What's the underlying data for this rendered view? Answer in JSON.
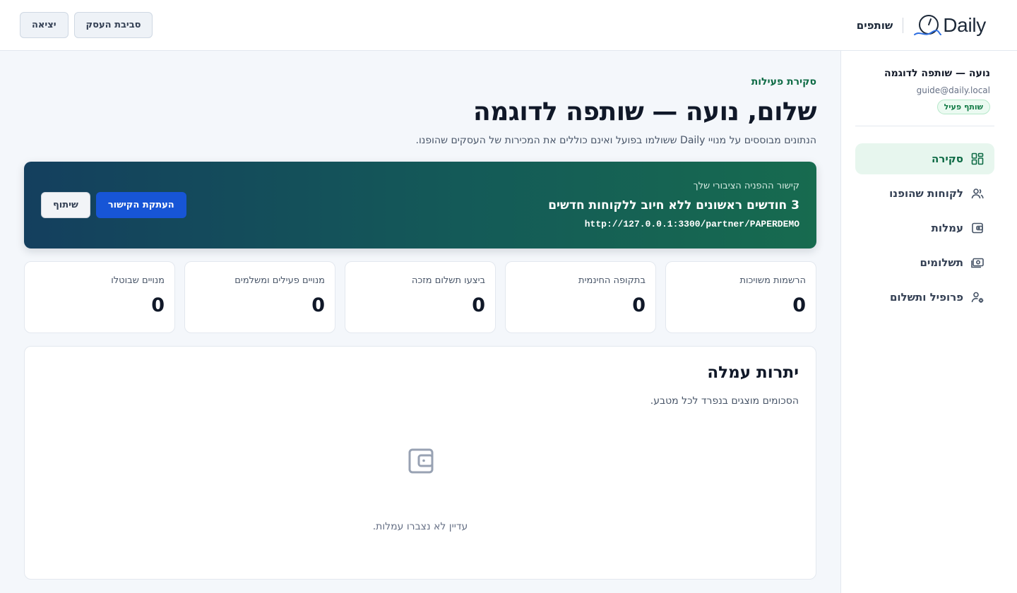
{
  "header": {
    "brand_name": "Daily",
    "section_title": "שותפים",
    "business_env_button": "סביבת העסק",
    "logout_button": "יציאה"
  },
  "sidebar": {
    "user": {
      "name": "נועה — שותפה לדוגמה",
      "email": "guide@daily.local",
      "status": "שותף פעיל"
    },
    "items": [
      {
        "label": "סקירה",
        "icon": "grid-icon",
        "active": true
      },
      {
        "label": "לקוחות שהופנו",
        "icon": "users-icon",
        "active": false
      },
      {
        "label": "עמלות",
        "icon": "wallet-icon",
        "active": false
      },
      {
        "label": "תשלומים",
        "icon": "cash-icon",
        "active": false
      },
      {
        "label": "פרופיל ותשלום",
        "icon": "user-settings-icon",
        "active": false
      }
    ]
  },
  "main": {
    "eyebrow": "סקירת פעילות",
    "title": "שלום, נועה — שותפה לדוגמה",
    "subtitle": "הנתונים מבוססים על מנויי Daily ששולמו בפועל ואינם כוללים את המכירות של העסקים שהופנו.",
    "hero": {
      "label": "קישור ההפניה הציבורי שלך",
      "title": "3 חודשים ראשונים ללא חיוב ללקוחות חדשים",
      "url": "http://127.0.0.1:3300/partner/PAPERDEMO",
      "copy_button": "העתקת הקישור",
      "share_button": "שיתוף"
    },
    "stats": [
      {
        "label": "הרשמות משויכות",
        "value": "0"
      },
      {
        "label": "בתקופה החינמית",
        "value": "0"
      },
      {
        "label": "ביצעו תשלום מזכה",
        "value": "0"
      },
      {
        "label": "מנויים פעילים ומשלמים",
        "value": "0"
      },
      {
        "label": "מנויים שבוטלו",
        "value": "0"
      }
    ],
    "balance": {
      "title": "יתרות עמלה",
      "subtitle": "הסכומים מוצגים בנפרד לכל מטבע.",
      "empty_text": "עדיין לא נצברו עמלות."
    }
  },
  "colors": {
    "accent_green": "#0e6b45",
    "primary_blue": "#1755d6",
    "hero_gradient_start": "#176b4f",
    "hero_gradient_end": "#143f5e"
  }
}
